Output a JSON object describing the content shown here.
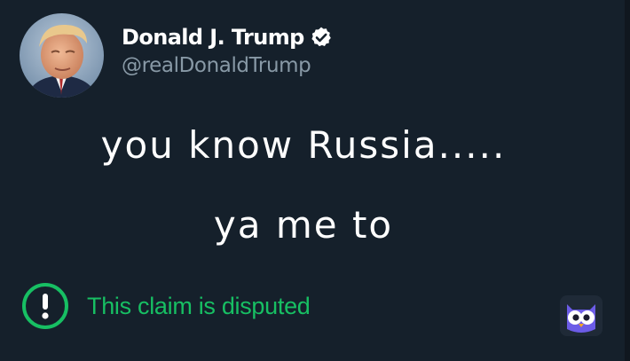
{
  "tweet": {
    "user": {
      "display_name": "Donald J. Trump",
      "handle": "@realDonaldTrump",
      "verified": true
    },
    "text_lines": [
      "you know Russia.....",
      "ya me to"
    ],
    "dispute_label": "This claim is disputed"
  },
  "colors": {
    "background": "#15202b",
    "text_primary": "#ffffff",
    "text_secondary": "#8899a6",
    "dispute_green": "#17bf63",
    "owl_badge": "#6c5ce7"
  },
  "icons": {
    "verified": "verified-badge-icon",
    "dispute": "exclamation-circle-icon",
    "watermark": "owl-logo"
  }
}
